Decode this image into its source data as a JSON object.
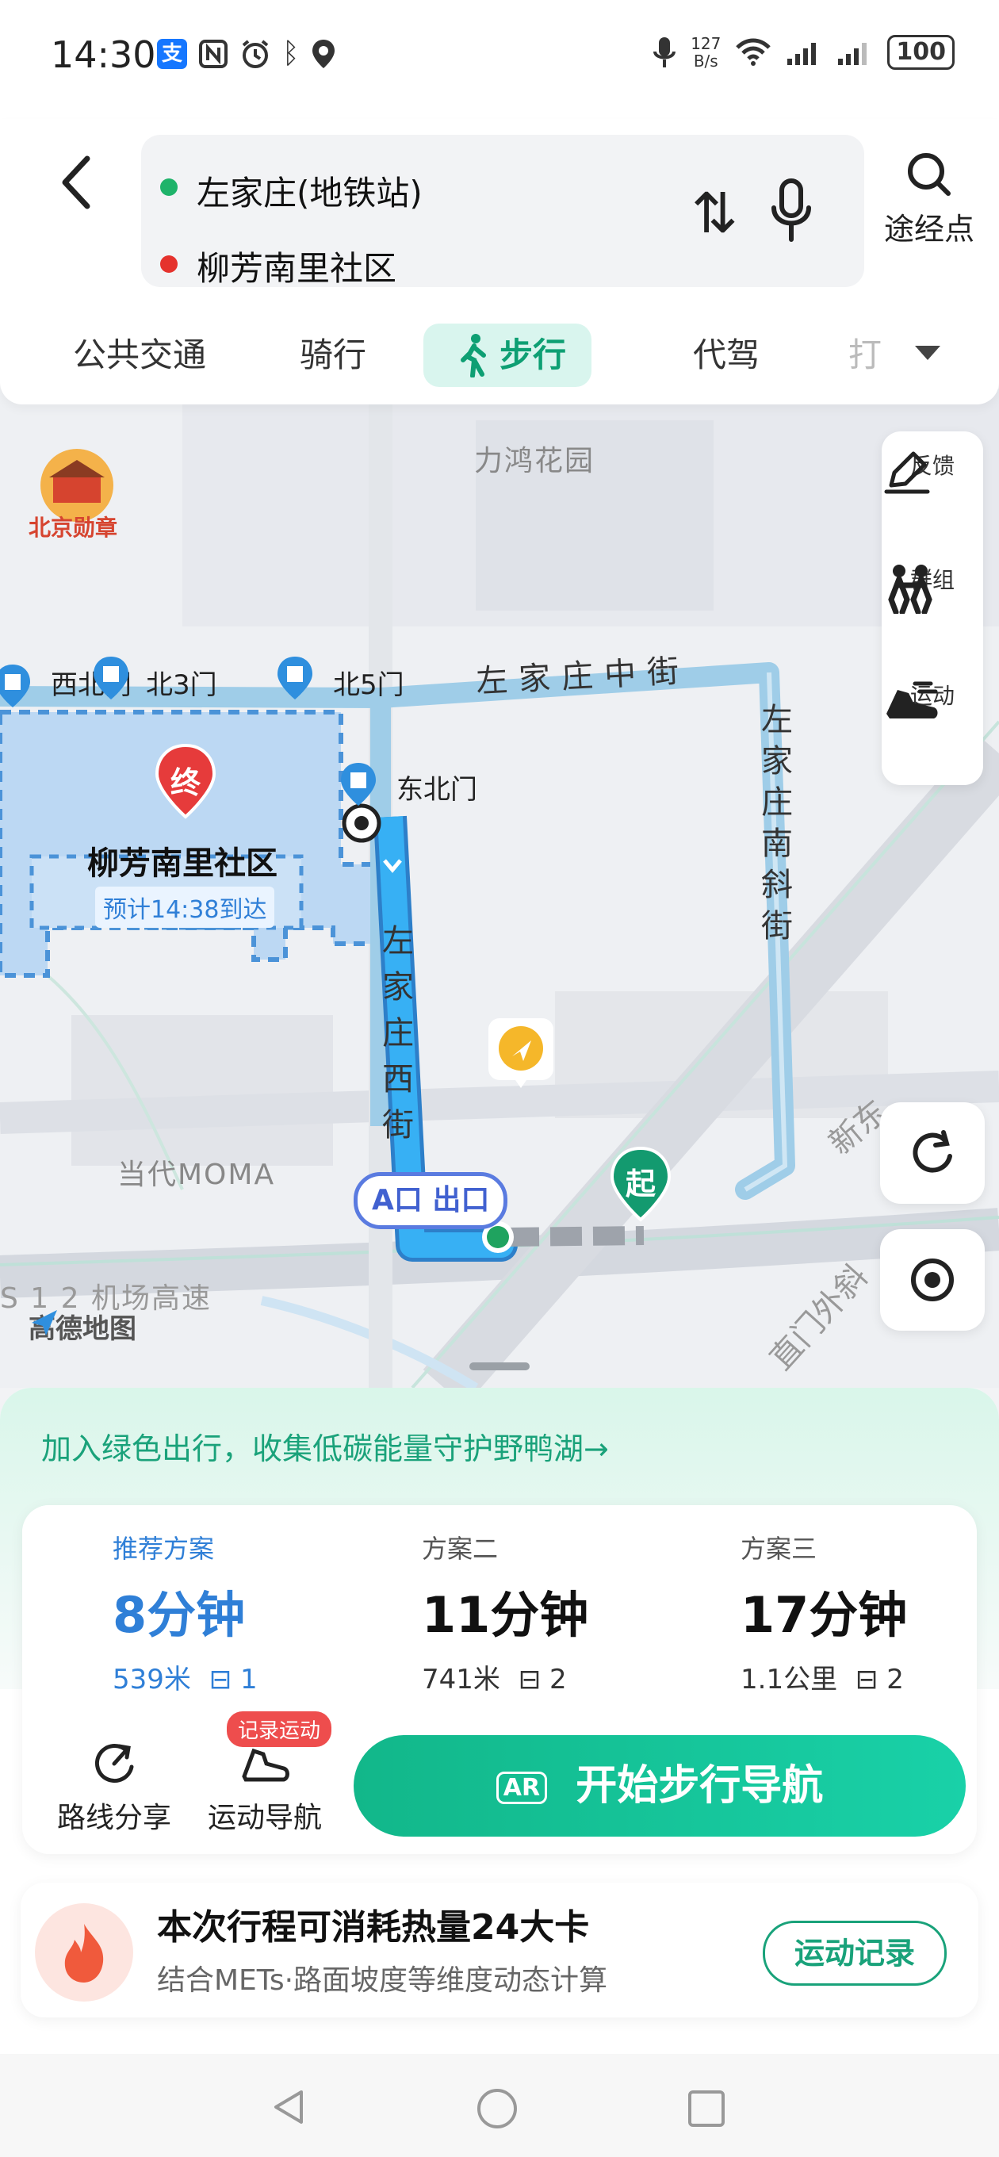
{
  "status_bar": {
    "time": "14:30",
    "alipay_icon": "支",
    "net_speed": "127\nB/s",
    "battery": "100"
  },
  "route": {
    "origin": "左家庄(地铁站)",
    "destination": "柳芳南里社区",
    "swap_symbol": "⇅",
    "via_label": "途经点",
    "origin_color": "#1fb36a",
    "dest_color": "#e5322d"
  },
  "tabs": [
    {
      "label": "公共交通"
    },
    {
      "label": "骑行"
    },
    {
      "label": "步行",
      "active": true
    },
    {
      "label": "代驾"
    },
    {
      "label": "打"
    }
  ],
  "map": {
    "badge_text": "北京勋章",
    "poi_lihong": "力鸿花园",
    "poi_moma": "当代MOMA",
    "gates": [
      "西北门",
      "北3门",
      "北5门",
      "东北门"
    ],
    "street_zhongjie": "左家庄中街",
    "street_nanxie": "左家庄南斜街",
    "street_xijie": "左家庄西街",
    "street_xin": "新东",
    "street_waixie": "直门外斜",
    "expressway": "S 1 2 机场高速",
    "end_marker": "终",
    "start_marker": "起",
    "destination_name": "柳芳南里社区",
    "eta": "预计14:38到达",
    "exit_label": "A口 出口",
    "amap_logo": "高德地图",
    "side_buttons": [
      {
        "label": "反馈"
      },
      {
        "label": "群组"
      },
      {
        "label": "运动"
      }
    ],
    "route_color": "#33a3f2"
  },
  "sheet": {
    "green_banner": "加入绿色出行，收集低碳能量守护野鸭湖→",
    "plans": [
      {
        "title": "推荐方案",
        "time": "8分钟",
        "distance": "539米",
        "lights": "1"
      },
      {
        "title": "方案二",
        "time": "11分钟",
        "distance": "741米",
        "lights": "2"
      },
      {
        "title": "方案三",
        "time": "17分钟",
        "distance": "1.1公里",
        "lights": "2"
      }
    ],
    "share_label": "路线分享",
    "sport_nav_label": "运动导航",
    "record_badge": "记录运动",
    "start_button": "开始步行导航",
    "ar_label": "AR",
    "calorie_title": "本次行程可消耗热量24大卡",
    "calorie_sub": "结合METs·路面坡度等维度动态计算",
    "calorie_button": "运动记录"
  }
}
